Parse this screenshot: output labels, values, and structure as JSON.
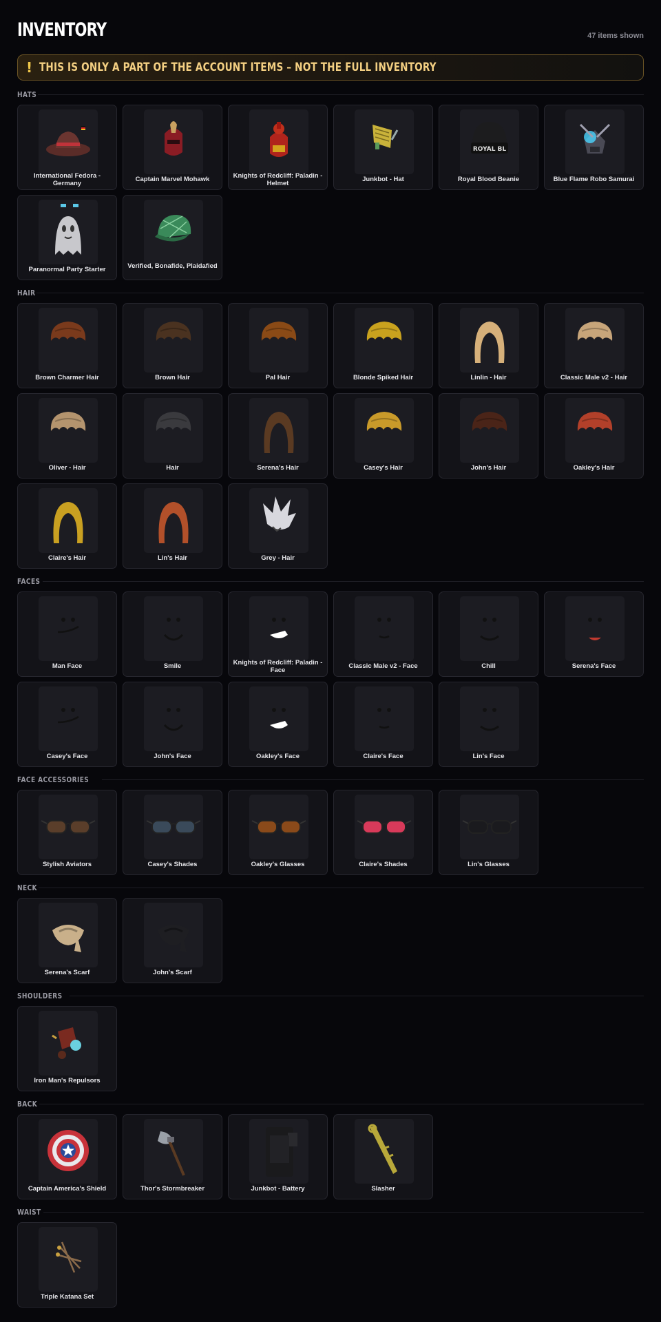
{
  "header": {
    "title": "INVENTORY",
    "count_text": "47 items shown"
  },
  "banner": {
    "icon": "!",
    "text": "THIS IS ONLY A PART OF THE ACCOUNT ITEMS – NOT THE FULL INVENTORY"
  },
  "colors": {
    "background": "#07070b",
    "card": "#131318",
    "thumb": "#1c1c22",
    "banner_text": "#f3cf82",
    "banner_border": "#6b5425"
  },
  "sections": [
    {
      "name": "HATS",
      "items": [
        {
          "name": "International Fedora - Germany",
          "icon": "fedora"
        },
        {
          "name": "Captain Marvel Mohawk",
          "icon": "mohawk-helmet"
        },
        {
          "name": "Knights of Redcliff: Paladin - Helmet",
          "icon": "paladin-helmet"
        },
        {
          "name": "Junkbot - Hat",
          "icon": "junkbot-hat"
        },
        {
          "name": "Royal Blood Beanie",
          "icon": "beanie"
        },
        {
          "name": "Blue Flame Robo Samurai",
          "icon": "robo-samurai"
        },
        {
          "name": "Paranormal Party Starter",
          "icon": "ghost"
        },
        {
          "name": "Verified, Bonafide, Plaidafied",
          "icon": "plaid-cap"
        }
      ]
    },
    {
      "name": "HAIR",
      "items": [
        {
          "name": "Brown Charmer Hair",
          "icon": "hair",
          "color": "#7a3a1c"
        },
        {
          "name": "Brown Hair",
          "icon": "hair",
          "color": "#4a3220"
        },
        {
          "name": "Pal Hair",
          "icon": "hair",
          "color": "#8a4a16"
        },
        {
          "name": "Blonde Spiked Hair",
          "icon": "hair",
          "color": "#c9a21e"
        },
        {
          "name": "Linlin - Hair",
          "icon": "hair-long",
          "color": "#d6b07a"
        },
        {
          "name": "Classic Male v2 - Hair",
          "icon": "hair",
          "color": "#c7a57a"
        },
        {
          "name": "Oliver - Hair",
          "icon": "hair",
          "color": "#b4946e"
        },
        {
          "name": "Hair",
          "icon": "hair",
          "color": "#3a3a3e"
        },
        {
          "name": "Serena's Hair",
          "icon": "hair-long",
          "color": "#5a3a22"
        },
        {
          "name": "Casey's Hair",
          "icon": "hair",
          "color": "#c99a2a"
        },
        {
          "name": "John's Hair",
          "icon": "hair",
          "color": "#4a2418"
        },
        {
          "name": "Oakley's Hair",
          "icon": "hair",
          "color": "#b2402a"
        },
        {
          "name": "Claire's Hair",
          "icon": "hair-long",
          "color": "#c9a021"
        },
        {
          "name": "Lin's Hair",
          "icon": "hair-long",
          "color": "#b2502a"
        },
        {
          "name": "Grey - Hair",
          "icon": "hair-spiky",
          "color": "#d8d8de"
        }
      ]
    },
    {
      "name": "FACES",
      "items": [
        {
          "name": "Man Face",
          "icon": "face"
        },
        {
          "name": "Smile",
          "icon": "face"
        },
        {
          "name": "Knights of Redcliff: Paladin - Face",
          "icon": "face"
        },
        {
          "name": "Classic Male v2 - Face",
          "icon": "face"
        },
        {
          "name": "Chill",
          "icon": "face"
        },
        {
          "name": "Serena's Face",
          "icon": "face"
        },
        {
          "name": "Casey's Face",
          "icon": "face"
        },
        {
          "name": "John's Face",
          "icon": "face"
        },
        {
          "name": "Oakley's Face",
          "icon": "face"
        },
        {
          "name": "Claire's Face",
          "icon": "face"
        },
        {
          "name": "Lin's Face",
          "icon": "face"
        }
      ]
    },
    {
      "name": "FACE ACCESSORIES",
      "items": [
        {
          "name": "Stylish Aviators",
          "icon": "glasses",
          "color": "#5a3e2a"
        },
        {
          "name": "Casey's Shades",
          "icon": "glasses",
          "color": "#3a4a5a"
        },
        {
          "name": "Oakley's Glasses",
          "icon": "glasses",
          "color": "#8a4a1a"
        },
        {
          "name": "Claire's Shades",
          "icon": "glasses",
          "color": "#d83a5a"
        },
        {
          "name": "Lin's Glasses",
          "icon": "glasses",
          "color": "#1a1a1e"
        }
      ]
    },
    {
      "name": "NECK",
      "items": [
        {
          "name": "Serena's Scarf",
          "icon": "scarf",
          "color": "#c9b08a"
        },
        {
          "name": "John's Scarf",
          "icon": "scarf",
          "color": "#1e1e22"
        }
      ]
    },
    {
      "name": "SHOULDERS",
      "items": [
        {
          "name": "Iron Man's Repulsors",
          "icon": "repulsors"
        }
      ]
    },
    {
      "name": "BACK",
      "items": [
        {
          "name": "Captain America's Shield",
          "icon": "shield"
        },
        {
          "name": "Thor's Stormbreaker",
          "icon": "axe"
        },
        {
          "name": "Junkbot - Battery",
          "icon": "battery"
        },
        {
          "name": "Slasher",
          "icon": "blade"
        }
      ]
    },
    {
      "name": "WAIST",
      "items": [
        {
          "name": "Triple Katana Set",
          "icon": "katanas"
        }
      ]
    }
  ]
}
